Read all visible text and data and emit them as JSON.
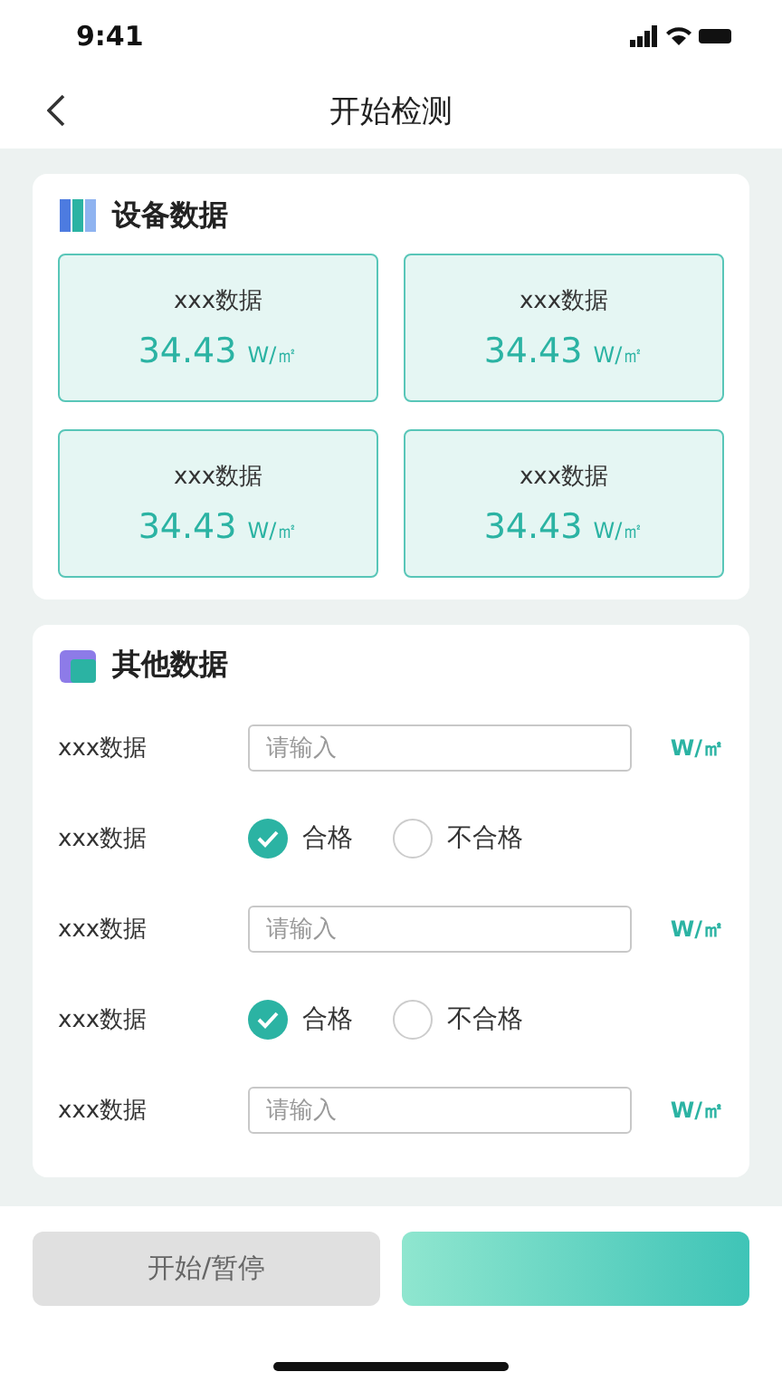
{
  "status_bar": {
    "time": "9:41"
  },
  "header": {
    "title": "开始检测"
  },
  "device_section": {
    "title": "设备数据",
    "tiles": [
      {
        "label": "xxx数据",
        "value": "34.43",
        "unit": "W/㎡"
      },
      {
        "label": "xxx数据",
        "value": "34.43",
        "unit": "W/㎡"
      },
      {
        "label": "xxx数据",
        "value": "34.43",
        "unit": "W/㎡"
      },
      {
        "label": "xxx数据",
        "value": "34.43",
        "unit": "W/㎡"
      }
    ]
  },
  "other_section": {
    "title": "其他数据",
    "rows": [
      {
        "kind": "input",
        "label": "xxx数据",
        "placeholder": "请输入",
        "unit": "W/㎡"
      },
      {
        "kind": "radio",
        "label": "xxx数据",
        "options": [
          {
            "label": "合格",
            "selected": true
          },
          {
            "label": "不合格",
            "selected": false
          }
        ]
      },
      {
        "kind": "input",
        "label": "xxx数据",
        "placeholder": "请输入",
        "unit": "W/㎡"
      },
      {
        "kind": "radio",
        "label": "xxx数据",
        "options": [
          {
            "label": "合格",
            "selected": true
          },
          {
            "label": "不合格",
            "selected": false
          }
        ]
      },
      {
        "kind": "input",
        "label": "xxx数据",
        "placeholder": "请输入",
        "unit": "W/㎡"
      }
    ]
  },
  "buttons": [
    {
      "kind": "secondary",
      "label": "开始/暂停"
    },
    {
      "kind": "primary"
    }
  ]
}
